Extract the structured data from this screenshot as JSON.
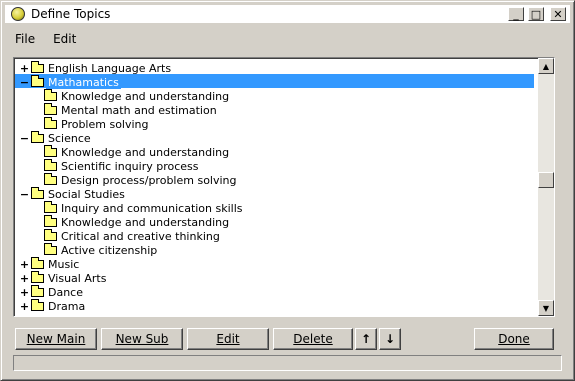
{
  "window": {
    "title": "Define Topics"
  },
  "titlebar_buttons": {
    "minimize": "_",
    "maximize": "□",
    "close": "✕"
  },
  "menu": [
    {
      "label": "File"
    },
    {
      "label": "Edit"
    }
  ],
  "tree": {
    "selected": "Mathamatics",
    "items": [
      {
        "label": "English Language Arts",
        "level": 0,
        "expander": "+"
      },
      {
        "label": "Mathamatics",
        "level": 0,
        "expander": "−"
      },
      {
        "label": "Knowledge and understanding",
        "level": 1
      },
      {
        "label": "Mental math and estimation",
        "level": 1
      },
      {
        "label": "Problem solving",
        "level": 1
      },
      {
        "label": "Science",
        "level": 0,
        "expander": "−"
      },
      {
        "label": "Knowledge and understanding",
        "level": 1
      },
      {
        "label": "Scientific inquiry process",
        "level": 1
      },
      {
        "label": "Design process/problem solving",
        "level": 1
      },
      {
        "label": "Social Studies",
        "level": 0,
        "expander": "−"
      },
      {
        "label": "Inquiry and communication skills",
        "level": 1
      },
      {
        "label": "Knowledge and understanding",
        "level": 1
      },
      {
        "label": "Critical and creative thinking",
        "level": 1
      },
      {
        "label": "Active citizenship",
        "level": 1
      },
      {
        "label": "Music",
        "level": 0,
        "expander": "+"
      },
      {
        "label": "Visual Arts",
        "level": 0,
        "expander": "+"
      },
      {
        "label": "Dance",
        "level": 0,
        "expander": "+"
      },
      {
        "label": "Drama",
        "level": 0,
        "expander": "+"
      }
    ]
  },
  "buttons": {
    "new_main": "New Main",
    "new_sub": "New Sub",
    "edit": "Edit",
    "delete": "Delete",
    "move_up": "↑",
    "move_down": "↓",
    "done": "Done"
  },
  "status": ""
}
